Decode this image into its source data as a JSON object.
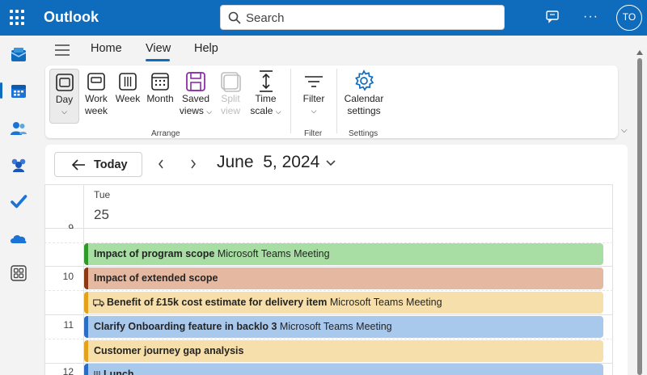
{
  "app": {
    "title": "Outlook",
    "avatar_initials": "TO"
  },
  "search": {
    "placeholder": "Search"
  },
  "menu": {
    "tabs": [
      "Home",
      "View",
      "Help"
    ],
    "active_tab": "View"
  },
  "ribbon": {
    "buttons": {
      "day": "Day",
      "work_week_1": "Work",
      "work_week_2": "week",
      "week": "Week",
      "month": "Month",
      "saved_views_1": "Saved",
      "saved_views_2": "views",
      "split_view_1": "Split",
      "split_view_2": "view",
      "time_scale_1": "Time",
      "time_scale_2": "scale",
      "filter": "Filter",
      "calendar_settings_1": "Calendar",
      "calendar_settings_2": "settings"
    },
    "groups": {
      "arrange": "Arrange",
      "filter": "Filter",
      "settings": "Settings"
    }
  },
  "calendar": {
    "today_label": "Today",
    "date_month": "June",
    "date_day_year": "5, 2024",
    "day_name": "Tue",
    "day_number": "25",
    "hours": [
      "9",
      "10",
      "11",
      "12"
    ],
    "events": [
      {
        "title": "Impact of program scope",
        "detail": "Microsoft Teams Meeting",
        "bg": "#a8dea4",
        "border": "#2f9a2a"
      },
      {
        "title": "Impact of extended scope",
        "detail": "",
        "bg": "#e5b9a1",
        "border": "#8a3b12"
      },
      {
        "title": "Benefit of £15k cost estimate for delivery item",
        "detail": "Microsoft Teams Meeting",
        "bg": "#f6dfaa",
        "border": "#e3a21a"
      },
      {
        "title": "Clarify Onboarding feature in backlo 3",
        "detail": "Microsoft Teams Meeting",
        "bg": "#a9c9ec",
        "border": "#2b6cc4"
      },
      {
        "title": "Customer journey gap analysis",
        "detail": "",
        "bg": "#f6dfaa",
        "border": "#e3a21a"
      },
      {
        "title": "Lunch",
        "detail": "",
        "bg": "#a9c9ec",
        "border": "#2b6cc4"
      }
    ]
  },
  "colors": {
    "brand": "#0f6cbd",
    "accent": "#0f6cbd",
    "saved_views_icon": "#8b2fa8"
  }
}
